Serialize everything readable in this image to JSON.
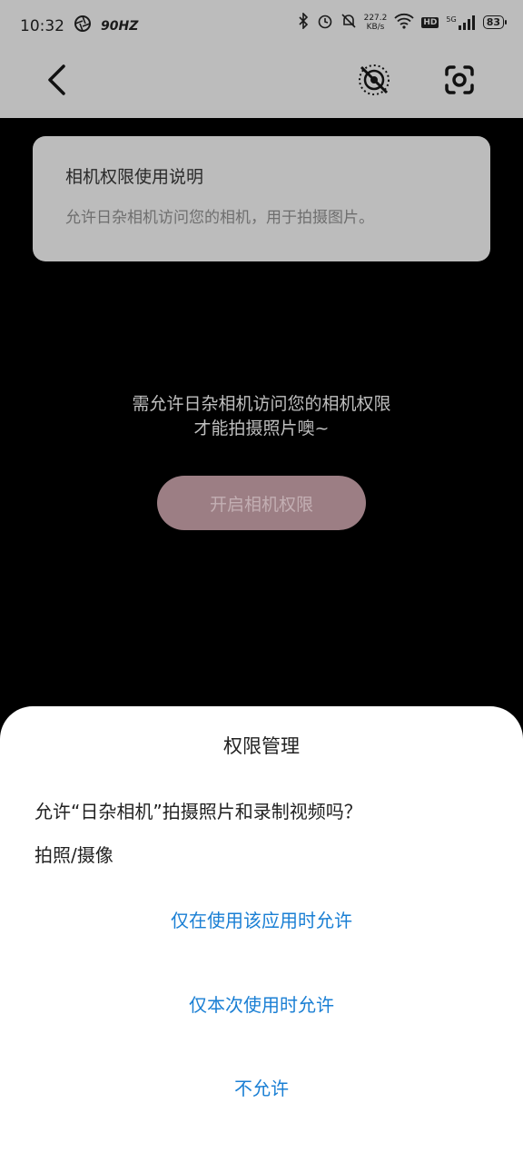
{
  "status": {
    "time": "10:32",
    "refresh": "90HZ",
    "speed_value": "227.2",
    "speed_unit": "KB/s",
    "hd": "HD",
    "network": "5G",
    "battery": "83"
  },
  "camera": {
    "card_title": "相机权限使用说明",
    "card_desc": "允许日杂相机访问您的相机，用于拍摄图片。",
    "hint_line1": "需允许日杂相机访问您的相机权限",
    "hint_line2": "才能拍摄照片噢~",
    "open_button": "开启相机权限"
  },
  "dialog": {
    "title": "权限管理",
    "message": "允许“日杂相机”拍摄照片和录制视频吗？",
    "permission": "拍照/摄像",
    "options": [
      "仅在使用该应用时允许",
      "仅本次使用时允许",
      "不允许"
    ]
  },
  "colors": {
    "accent": "#1a7fd4",
    "dim_overlay": "#bcbcbc",
    "button_bg": "#9c7e84"
  }
}
